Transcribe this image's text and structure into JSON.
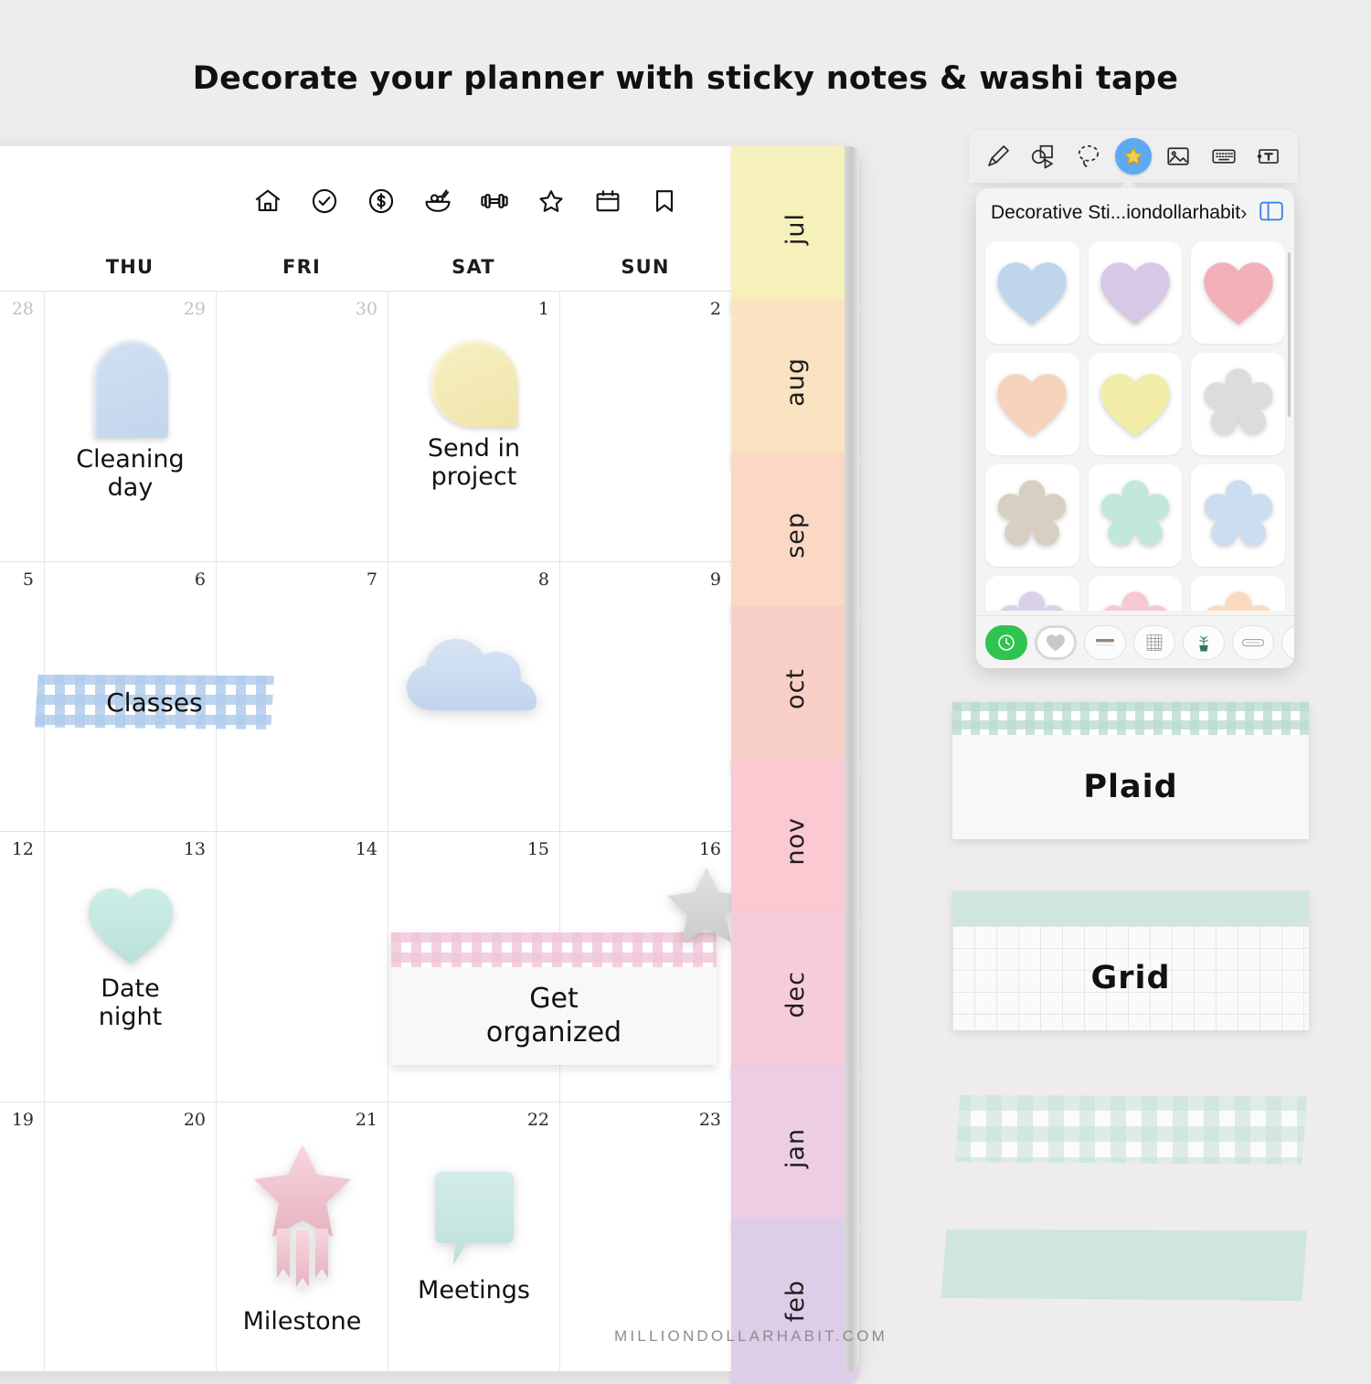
{
  "page": {
    "title": "Decorate your planner with sticky notes & washi tape",
    "watermark": "MILLIONDOLLARHABIT.COM"
  },
  "planner": {
    "icon_row": [
      {
        "name": "home-icon",
        "label": "Home"
      },
      {
        "name": "check-circle-icon",
        "label": "Tasks"
      },
      {
        "name": "dollar-circle-icon",
        "label": "Finance"
      },
      {
        "name": "food-bowl-icon",
        "label": "Meals"
      },
      {
        "name": "dumbbell-icon",
        "label": "Fitness"
      },
      {
        "name": "star-icon",
        "label": "Favorites"
      },
      {
        "name": "calendar-icon",
        "label": "Calendar"
      },
      {
        "name": "bookmark-icon",
        "label": "Bookmark"
      }
    ],
    "day_headers": [
      "",
      "THU",
      "FRI",
      "SAT",
      "SUN"
    ],
    "weeks": [
      {
        "days": [
          {
            "num": "28",
            "muted": true
          },
          {
            "num": "29",
            "muted": true,
            "entry": {
              "type": "arch",
              "caption": "Cleaning\nday",
              "color": "#cbdcf0"
            }
          },
          {
            "num": "30",
            "muted": true
          },
          {
            "num": "1",
            "muted": false,
            "entry": {
              "type": "teardrop",
              "caption": "Send in\nproject",
              "color": "#f3ecbb"
            }
          },
          {
            "num": "2",
            "muted": false
          }
        ]
      },
      {
        "days": [
          {
            "num": "5",
            "muted": false
          },
          {
            "num": "6",
            "muted": false
          },
          {
            "num": "7",
            "muted": false
          },
          {
            "num": "8",
            "muted": false,
            "entry": {
              "type": "cloud",
              "caption": "",
              "color": "#ccdcf1"
            }
          },
          {
            "num": "9",
            "muted": false
          }
        ]
      },
      {
        "days": [
          {
            "num": "12",
            "muted": false
          },
          {
            "num": "13",
            "muted": false,
            "entry": {
              "type": "heart",
              "caption": "Date\nnight",
              "color": "#c3e6e0"
            }
          },
          {
            "num": "14",
            "muted": false
          },
          {
            "num": "15",
            "muted": false
          },
          {
            "num": "16",
            "muted": false
          }
        ]
      },
      {
        "days": [
          {
            "num": "19",
            "muted": false
          },
          {
            "num": "20",
            "muted": false
          },
          {
            "num": "21",
            "muted": false,
            "entry": {
              "type": "shooting-star",
              "caption": "Milestone",
              "color": "#f2c9d2"
            }
          },
          {
            "num": "22",
            "muted": false,
            "entry": {
              "type": "speech-bubble",
              "caption": "Meetings",
              "color": "#c6e7e1"
            }
          },
          {
            "num": "23",
            "muted": false
          }
        ]
      }
    ],
    "overlays": {
      "classes_washi": {
        "label": "Classes",
        "pattern": "gingham-blue"
      },
      "get_organized_note": {
        "label": "Get\norganized",
        "header_pattern": "gingham-pink"
      },
      "gray_star": {
        "name": "gray-star-sticker",
        "color": "#d4d4d4"
      },
      "partial_flower": {
        "name": "blue-flower-sticker",
        "color": "#ccdcf1"
      },
      "partial_caption": "day"
    },
    "month_tabs": [
      {
        "label": "jul",
        "color": "#f6f0bb"
      },
      {
        "label": "aug",
        "color": "#fae3c0"
      },
      {
        "label": "sep",
        "color": "#fbd8c3"
      },
      {
        "label": "oct",
        "color": "#f8cfc6"
      },
      {
        "label": "nov",
        "color": "#fac9d2"
      },
      {
        "label": "dec",
        "color": "#f6ccdd"
      },
      {
        "label": "jan",
        "color": "#eccde4"
      },
      {
        "label": "feb",
        "color": "#ddcde9"
      }
    ]
  },
  "sticker_picker": {
    "toolbar": [
      {
        "name": "pen-icon",
        "active": false
      },
      {
        "name": "shapes-icon",
        "active": false
      },
      {
        "name": "lasso-icon",
        "active": false
      },
      {
        "name": "sticker-star-icon",
        "active": true
      },
      {
        "name": "image-icon",
        "active": false
      },
      {
        "name": "keyboard-icon",
        "active": false
      },
      {
        "name": "text-box-icon",
        "active": false
      }
    ],
    "title": "Decorative Sti...iondollarhabit",
    "chevron": "›",
    "split_view_icon": "split-view-icon",
    "stickers": [
      {
        "shape": "heart",
        "color": "#bed5ec",
        "name": "blue-heart"
      },
      {
        "shape": "heart",
        "color": "#d7c9e6",
        "name": "purple-heart"
      },
      {
        "shape": "heart",
        "color": "#f2b0b8",
        "name": "pink-heart"
      },
      {
        "shape": "heart",
        "color": "#f8d3bb",
        "name": "peach-heart"
      },
      {
        "shape": "heart",
        "color": "#f2eda8",
        "name": "yellow-heart"
      },
      {
        "shape": "flower",
        "color": "#dcdcdc",
        "name": "gray-flower"
      },
      {
        "shape": "flower",
        "color": "#d8cfc2",
        "name": "tan-flower"
      },
      {
        "shape": "flower",
        "color": "#c2e8de",
        "name": "mint-flower"
      },
      {
        "shape": "flower",
        "color": "#ccdcf1",
        "name": "blue-flower"
      },
      {
        "shape": "flower",
        "color": "#dbcfe9",
        "name": "lavender-flower"
      },
      {
        "shape": "flower",
        "color": "#f6c8d4",
        "name": "pink-flower"
      },
      {
        "shape": "flower",
        "color": "#fadbc0",
        "name": "peach-flower"
      }
    ],
    "tabs": [
      {
        "name": "recents-clock-icon",
        "state": "active"
      },
      {
        "name": "heart-category-icon",
        "state": "selected"
      },
      {
        "name": "washi-line-icon",
        "state": "normal"
      },
      {
        "name": "grid-paper-icon",
        "state": "normal"
      },
      {
        "name": "plant-icon",
        "state": "normal"
      },
      {
        "name": "pill-label-icon",
        "state": "normal"
      },
      {
        "name": "circle-icon",
        "state": "normal"
      }
    ]
  },
  "samples": [
    {
      "label": "Plaid",
      "header_pattern": "gingham-mint",
      "name": "plaid-sample-card"
    },
    {
      "label": "Grid",
      "header_pattern": "solid-mint",
      "body_pattern": "grid-paper",
      "name": "grid-sample-card"
    }
  ],
  "tape_strips": [
    {
      "name": "gingham-mint-tape",
      "pattern": "gingham-mint-soft"
    },
    {
      "name": "solid-mint-tape",
      "pattern": "solid-mint"
    }
  ]
}
